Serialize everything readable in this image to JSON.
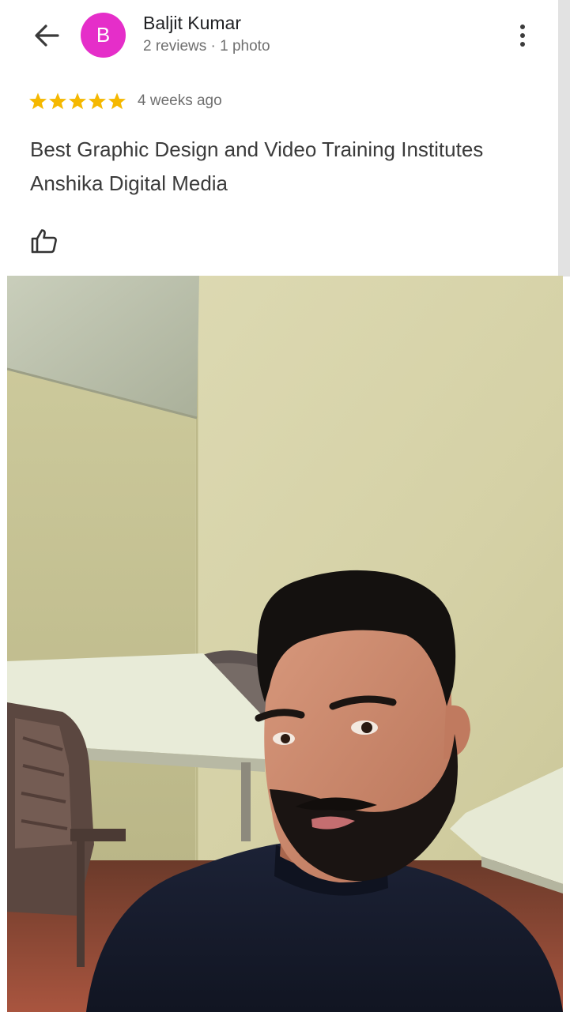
{
  "header": {
    "reviewer_name": "Baljit Kumar",
    "reviewer_meta": "2 reviews · 1 photo",
    "avatar_initial": "B",
    "avatar_color": "#e52ec9"
  },
  "review": {
    "rating": 5,
    "max_rating": 5,
    "star_color": "#f5b800",
    "date": "4 weeks ago",
    "text_lines": [
      "Best Graphic Design and Video Training Institutes",
      "Anshika Digital Media"
    ]
  },
  "icons": {
    "back": "arrow-back-icon",
    "more": "more-vert-icon",
    "like": "thumbs-up-icon"
  }
}
